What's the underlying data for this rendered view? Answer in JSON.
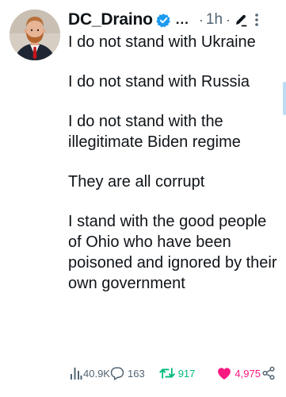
{
  "tweet": {
    "username": "DC_Draino",
    "ellipsis": "...",
    "separator": "·",
    "time": "1h",
    "paragraphs": [
      "I do not stand with Ukraine",
      "I do not stand with Russia",
      "I do not stand with the illegitimate Biden regime",
      "They are all corrupt",
      "I stand with the good people of Ohio who have been poisoned and ignored by their own government"
    ]
  },
  "stats": {
    "views": "40.9K",
    "replies": "163",
    "retweets": "917",
    "likes": "4,975"
  },
  "icons": {
    "verified": "verified-badge-icon",
    "grok": "grok-icon",
    "more": "more-vertical-icon",
    "views": "bar-chart-icon",
    "reply": "reply-bubble-icon",
    "retweet": "retweet-icon",
    "like": "heart-icon",
    "share": "share-icon"
  },
  "colors": {
    "text": "#0f1419",
    "secondary": "#536471",
    "verified_blue": "#1d9bf0",
    "retweet_green": "#00ba7c",
    "like_pink": "#f91880",
    "scroll_indicator": "#bcdcf4"
  }
}
